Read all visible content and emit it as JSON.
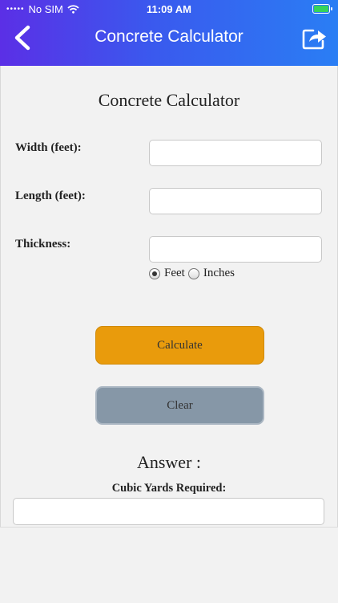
{
  "status_bar": {
    "carrier": "No SIM",
    "time": "11:09 AM"
  },
  "header": {
    "title": "Concrete Calculator"
  },
  "form": {
    "heading": "Concrete Calculator",
    "width_label": "Width (feet):",
    "width_value": "",
    "length_label": "Length (feet):",
    "length_value": "",
    "thickness_label": "Thickness:",
    "thickness_value": "",
    "unit_options": [
      "Feet",
      "Inches"
    ],
    "unit_selected": "Feet"
  },
  "buttons": {
    "calculate": "Calculate",
    "clear": "Clear"
  },
  "answer": {
    "heading": "Answer :",
    "cubic_label": "Cubic Yards Required:",
    "value": ""
  },
  "colors": {
    "header_gradient_start": "#5b2fe6",
    "header_gradient_end": "#2a7ef4",
    "calculate_button": "#e99b0c",
    "clear_button": "#8697a7",
    "battery": "#35d35a"
  },
  "icons": [
    "back-chevron-icon",
    "share-icon",
    "wifi-icon",
    "battery-icon",
    "signal-dots-icon"
  ]
}
